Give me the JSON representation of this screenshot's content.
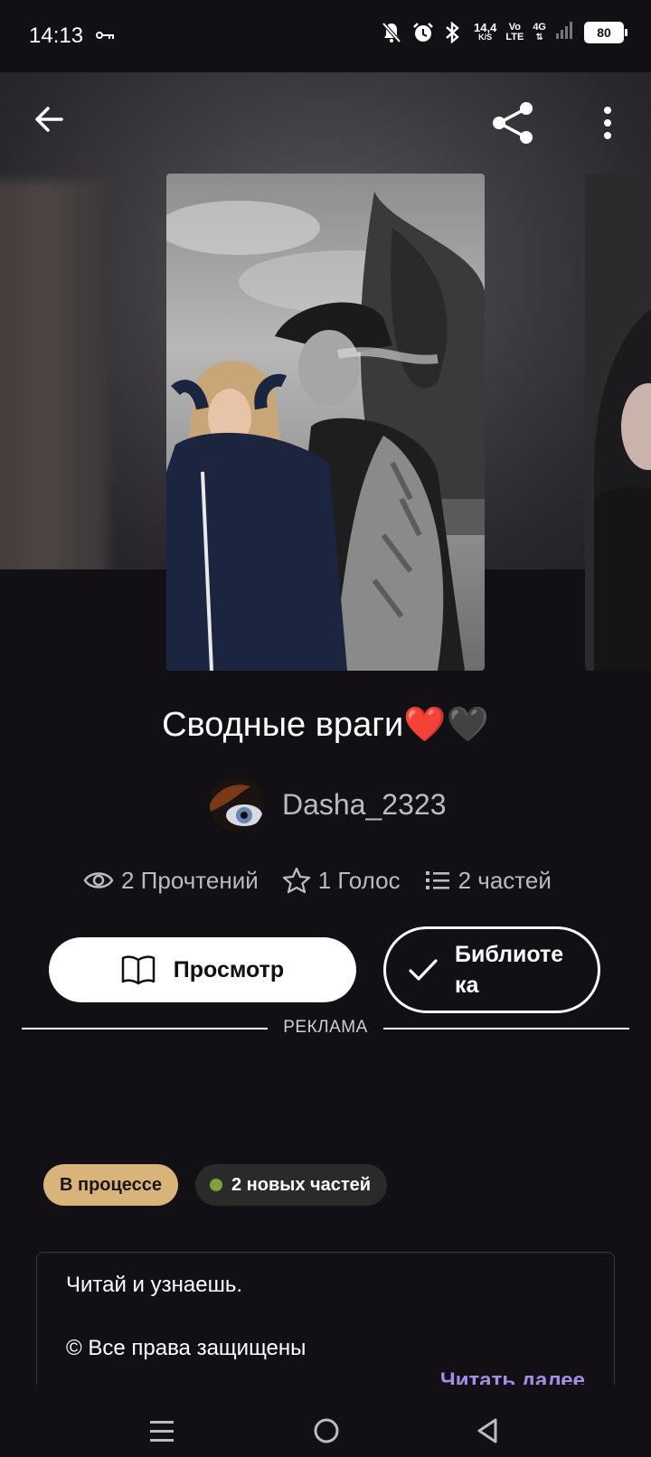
{
  "status_bar": {
    "time": "14:13",
    "network_speed_value": "14,4",
    "network_speed_unit": "K/S",
    "volte_top": "Vo",
    "volte_bottom": "LTE",
    "network_type": "4G",
    "battery": "80"
  },
  "story": {
    "title": "Сводные враги❤️🖤",
    "author": "Dasha_2323",
    "stats": {
      "reads": "2 Прочтений",
      "votes": "1 Голос",
      "parts": "2 частей"
    }
  },
  "actions": {
    "preview_label": "Просмотр",
    "library_label": "Библиоте ка"
  },
  "ad": {
    "label": "РЕКЛАМА"
  },
  "badges": {
    "status": "В процессе",
    "new_parts": "2 новых частей"
  },
  "description": {
    "line1": "Читай и узнаешь.",
    "line2": "© Все права защищены",
    "read_more": "Читать далее"
  },
  "colors": {
    "background": "#121014",
    "status_badge": "#d8b47a",
    "new_dot": "#7fa03a",
    "read_more": "#a58ee6"
  },
  "icons": {
    "back": "arrow-left-icon",
    "share": "share-icon",
    "more": "more-vertical-icon",
    "reads": "eye-icon",
    "votes": "star-icon",
    "parts": "list-icon",
    "preview": "book-icon",
    "library": "check-icon"
  }
}
